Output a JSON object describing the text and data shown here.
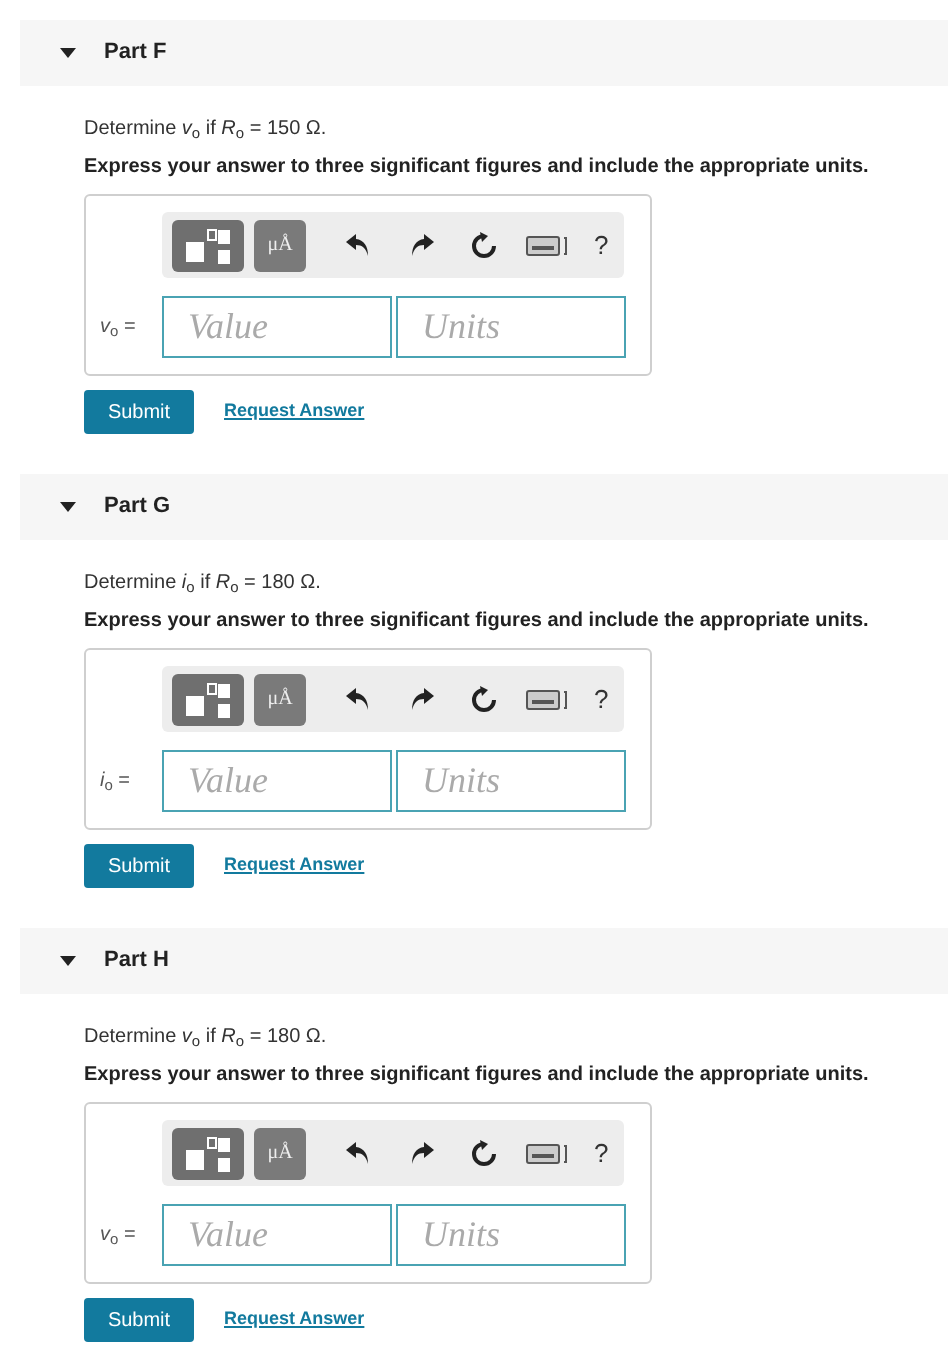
{
  "parts": [
    {
      "title": "Part F",
      "expanded": true,
      "question": "Determine *v*$_{o}$ if *R*$_{o}$ = 150 Ω.",
      "instruction": "Express your answer to three significant figures and include the appropriate units.",
      "toolbar": {
        "units_label": "μÅ",
        "help": "?"
      },
      "answer_label": "*v*$_{o}$ =",
      "value_placeholder": "Value",
      "units_placeholder": "Units",
      "submit": "Submit",
      "request": "Request Answer"
    },
    {
      "title": "Part G",
      "expanded": true,
      "question": "Determine *i*$_{o}$ if *R*$_{o}$ = 180 Ω.",
      "instruction": "Express your answer to three significant figures and include the appropriate units.",
      "toolbar": {
        "units_label": "μÅ",
        "help": "?"
      },
      "answer_label": "*i*$_{o}$ =",
      "value_placeholder": "Value",
      "units_placeholder": "Units",
      "submit": "Submit",
      "request": "Request Answer"
    },
    {
      "title": "Part H",
      "expanded": true,
      "question": "Determine *v*$_{o}$ if *R*$_{o}$ = 180 Ω.",
      "instruction": "Express your answer to three significant figures and include the appropriate units.",
      "toolbar": {
        "units_label": "μÅ",
        "help": "?"
      },
      "answer_label": "*v*$_{o}$ =",
      "value_placeholder": "Value",
      "units_placeholder": "Units",
      "submit": "Submit",
      "request": "Request Answer"
    }
  ]
}
